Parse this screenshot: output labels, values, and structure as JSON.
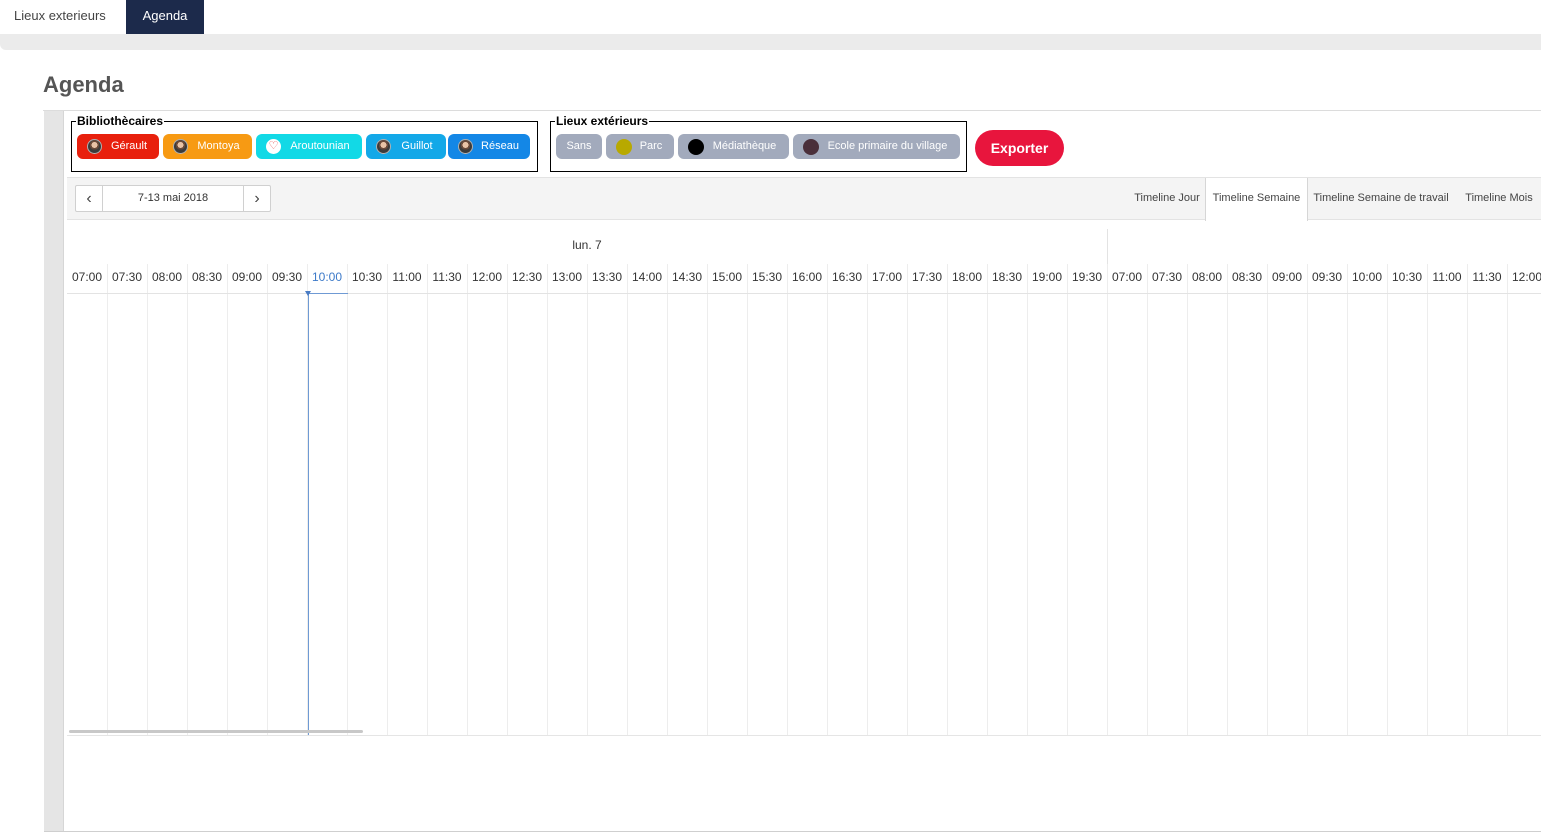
{
  "top_tabs": [
    {
      "label": "Lieux exterieurs",
      "active": false
    },
    {
      "label": "Agenda",
      "active": true
    }
  ],
  "page_title": "Agenda",
  "librarians": {
    "legend": "Bibliothècaires",
    "items": [
      {
        "label": "Gérault",
        "color": "#e8200d",
        "icon": "avatar-icon"
      },
      {
        "label": "Montoya",
        "color": "#f79a13",
        "icon": "avatar-icon"
      },
      {
        "label": "Aroutounian",
        "color": "#12d9e6",
        "icon": "heart-icon"
      },
      {
        "label": "Guillot",
        "color": "#13a8e8",
        "icon": "avatar-icon"
      },
      {
        "label": "Réseau",
        "color": "#1487e6",
        "icon": "avatar-icon"
      }
    ]
  },
  "places": {
    "legend": "Lieux extérieurs",
    "items": [
      {
        "label": "Sans",
        "color": "#a2aabc",
        "dot": null
      },
      {
        "label": "Parc",
        "color": "#a2aabc",
        "dot": "#b8a900"
      },
      {
        "label": "Médiathèque",
        "color": "#a2aabc",
        "dot": "#000000"
      },
      {
        "label": "Ecole primaire du village",
        "color": "#a2aabc",
        "dot": "#4a2f3a"
      }
    ]
  },
  "export_label": "Exporter",
  "toolbar": {
    "date_range": "7-13 mai 2018",
    "views": [
      {
        "label": "Timeline Jour",
        "active": false
      },
      {
        "label": "Timeline Semaine",
        "active": true
      },
      {
        "label": "Timeline Semaine de travail",
        "active": false
      },
      {
        "label": "Timeline Mois",
        "active": false
      }
    ]
  },
  "timeline": {
    "day_label": "lun. 7",
    "current_time": "10:00",
    "hours": [
      "07:00",
      "07:30",
      "08:00",
      "08:30",
      "09:00",
      "09:30",
      "10:00",
      "10:30",
      "11:00",
      "11:30",
      "12:00",
      "12:30",
      "13:00",
      "13:30",
      "14:00",
      "14:30",
      "15:00",
      "15:30",
      "16:00",
      "16:30",
      "17:00",
      "17:30",
      "18:00",
      "18:30",
      "19:00",
      "19:30",
      "07:00",
      "07:30",
      "08:00",
      "08:30",
      "09:00",
      "09:30",
      "10:00",
      "10:30",
      "11:00",
      "11:30",
      "12:00"
    ]
  }
}
